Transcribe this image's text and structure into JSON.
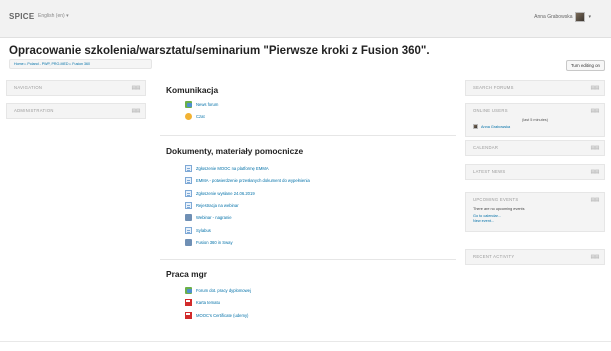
{
  "topbar": {
    "brand": "SPICE",
    "language": "English (en) ▾",
    "user_name": "Anna Grabowska",
    "caret": "▾"
  },
  "page": {
    "title": "Opracowanie szkolenia/warsztatu/seminarium \"Pierwsze kroki z Fusion 360\".",
    "breadcrumb": "Home ▹ Poland - PWP, PRO-MED ▹ Fusion 360",
    "turn_editing": "Turn editing on"
  },
  "left_blocks": [
    {
      "title": "NAVIGATION"
    },
    {
      "title": "ADMINISTRATION"
    }
  ],
  "right_blocks": {
    "search_forums": "SEARCH FORUMS",
    "online_users": {
      "title": "ONLINE USERS",
      "subtitle": "(last 5 minutes)",
      "user": "Anna Grabowska"
    },
    "calendar": "CALENDAR",
    "latest_news": "LATEST NEWS",
    "upcoming": {
      "title": "UPCOMING EVENTS",
      "text": "There are no upcoming events",
      "link1": "Go to calendar...",
      "link2": "New event..."
    },
    "recent_activity": "RECENT ACTIVITY"
  },
  "block_control": "▤▤",
  "sections": {
    "komunikacja": {
      "title": "Komunikacja",
      "items": [
        {
          "label": "News forum",
          "icon": "forum-icon"
        },
        {
          "label": "Czat",
          "icon": "chat-icon"
        }
      ]
    },
    "dokumenty": {
      "title": "Dokumenty, materiały pomocnicze",
      "items": [
        {
          "label": "Zgłoszenie MOOC na platformę EMMA",
          "icon": "file-icon"
        },
        {
          "label": "EMMA - potwierdzenie przesłanych dokument do wypełnienia",
          "icon": "file-icon"
        },
        {
          "label": "Zgłoszenie wysłane 24.06.2019",
          "icon": "file-icon"
        },
        {
          "label": "Rejestracja na webinar",
          "icon": "file-icon"
        },
        {
          "label": "Webinar - nagranie",
          "icon": "page-icon"
        },
        {
          "label": "Sylabus",
          "icon": "file-icon"
        },
        {
          "label": "Fusion 360 in Sway",
          "icon": "page-icon"
        }
      ]
    },
    "praca": {
      "title": "Praca mgr",
      "items": [
        {
          "label": "Forum dot. pracy dyplomowej",
          "icon": "forum-icon"
        },
        {
          "label": "Karta tematu",
          "icon": "pdf-icon"
        },
        {
          "label": "MOOC's Certificate (udemy)",
          "icon": "pdf-icon"
        }
      ]
    }
  }
}
